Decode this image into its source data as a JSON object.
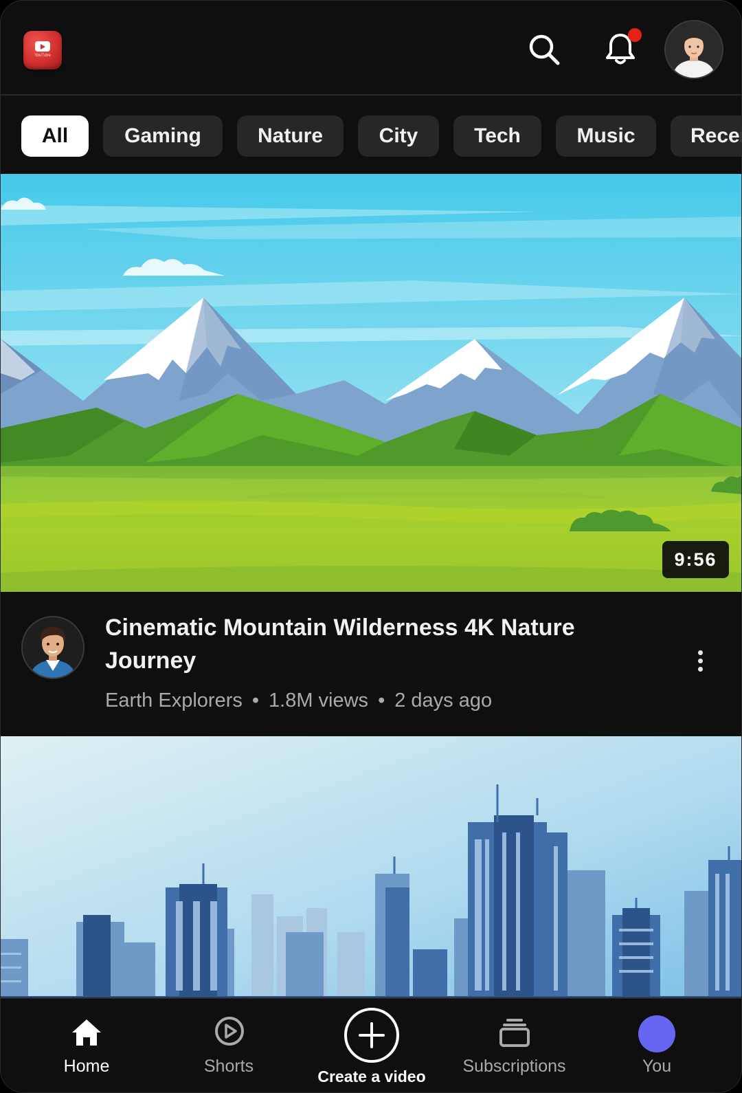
{
  "colors": {
    "background": "#0f0f0f",
    "chip_inactive": "#272727",
    "chip_active": "#ffffff",
    "notification_dot": "#e62117",
    "brand_red": "#d32f2f",
    "you_avatar": "#6666f2",
    "meta_text": "#aaaaaa"
  },
  "header": {
    "logo_icon": "app-logo-icon",
    "logo_caption": "YouTube",
    "search_icon": "search-icon",
    "notifications_icon": "bell-icon",
    "notifications_has_unread": true,
    "account_icon": "user-avatar"
  },
  "chips": [
    {
      "label": "All",
      "active": true
    },
    {
      "label": "Gaming",
      "active": false
    },
    {
      "label": "Nature",
      "active": false
    },
    {
      "label": "City",
      "active": false
    },
    {
      "label": "Tech",
      "active": false
    },
    {
      "label": "Music",
      "active": false
    },
    {
      "label": "Recen",
      "active": false
    }
  ],
  "feed": [
    {
      "thumbnail": "mountain-landscape",
      "duration": "9:56",
      "title": "Cinematic Mountain Wilderness 4K Nature Journey",
      "channel": "Earth Explorers",
      "views": "1.8M views",
      "age": "2 days ago",
      "menu_icon": "more-vertical-icon"
    },
    {
      "thumbnail": "city-skyline"
    }
  ],
  "meta_separator": "•",
  "bottom_nav": {
    "home": {
      "label": "Home",
      "icon": "home-icon",
      "active": true
    },
    "shorts": {
      "label": "Shorts",
      "icon": "shorts-play-icon",
      "active": false
    },
    "create": {
      "label": "Create a video",
      "icon": "plus-circle-icon",
      "active": false
    },
    "subscriptions": {
      "label": "Subscriptions",
      "icon": "subscriptions-icon",
      "active": false
    },
    "you": {
      "label": "You",
      "icon": "you-avatar",
      "active": false
    }
  }
}
